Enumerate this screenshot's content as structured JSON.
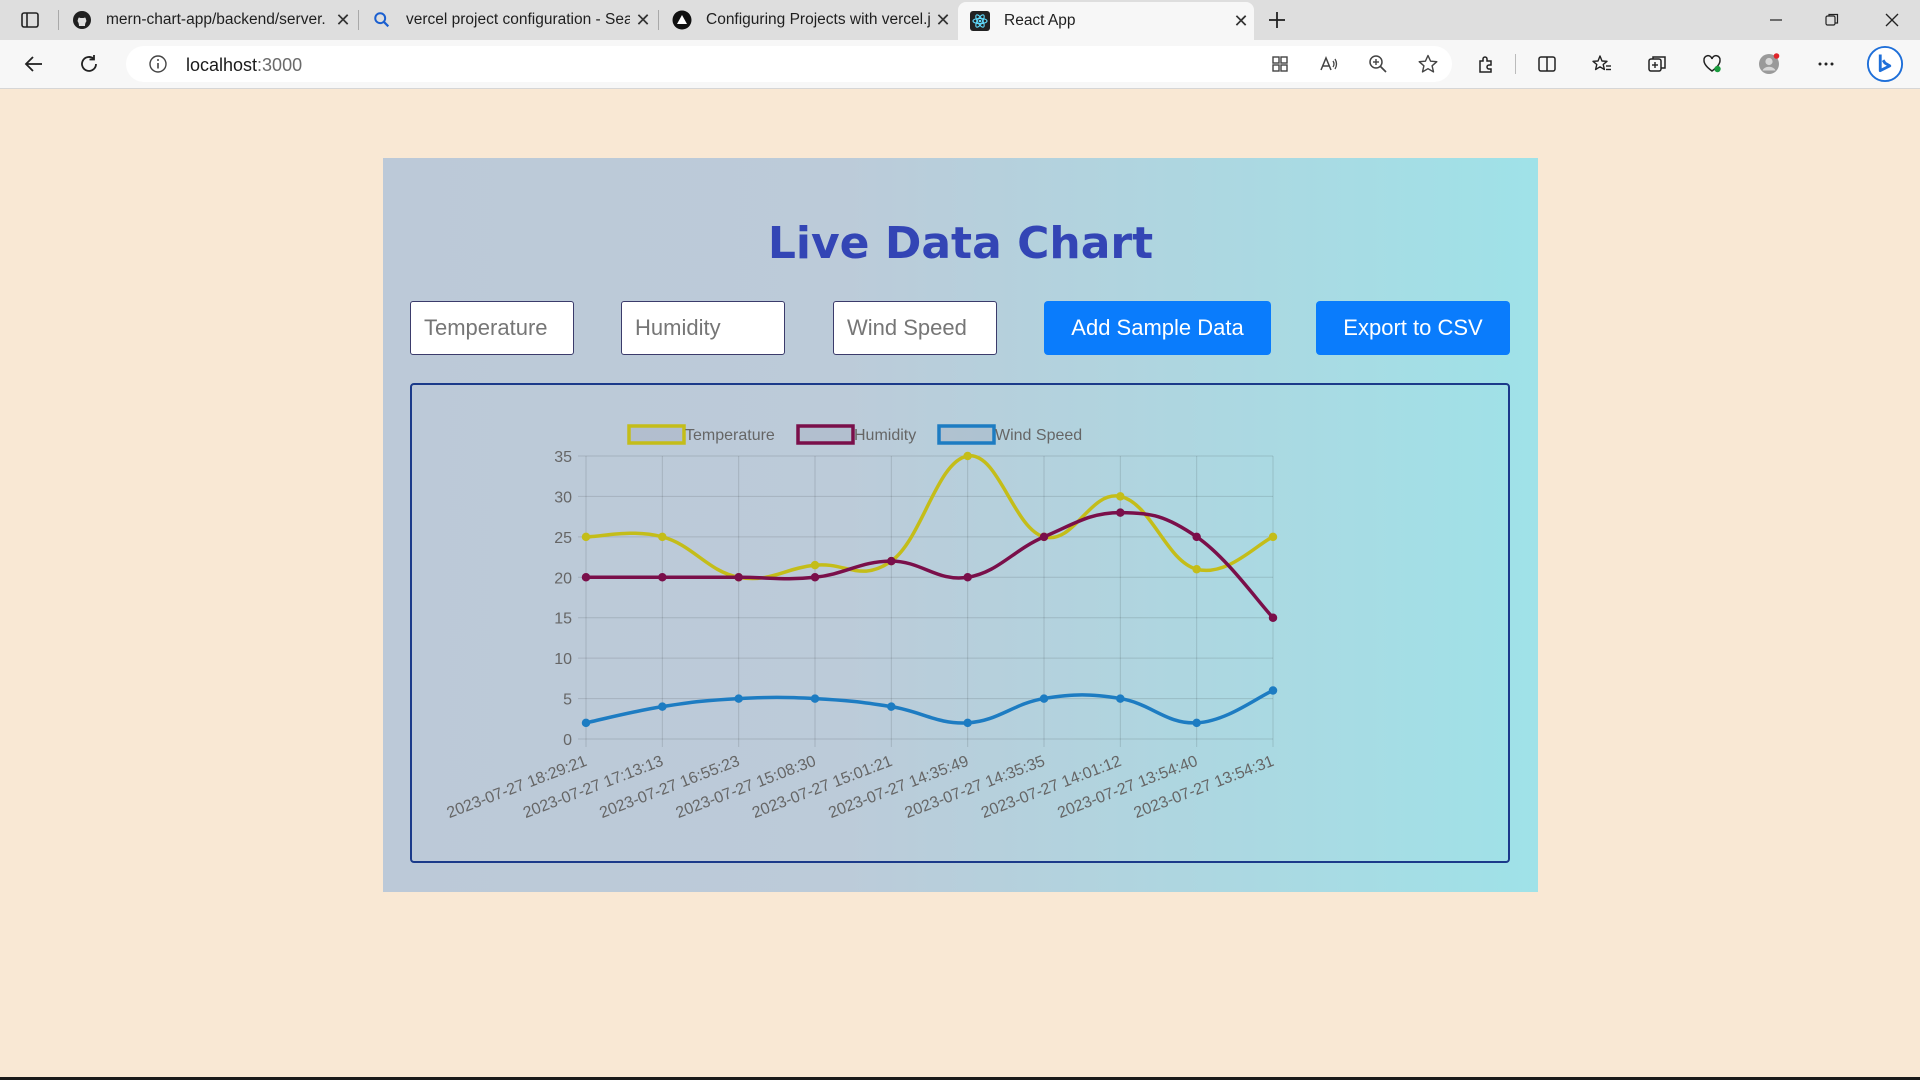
{
  "browser": {
    "tabs": [
      {
        "title": "mern-chart-app/backend/server.",
        "icon": "github-icon",
        "active": false
      },
      {
        "title": "vercel project configuration - Sea",
        "icon": "search-icon",
        "active": false
      },
      {
        "title": "Configuring Projects with vercel.j",
        "icon": "vercel-icon",
        "active": false
      },
      {
        "title": "React App",
        "icon": "react-icon",
        "active": true
      }
    ],
    "address": {
      "host": "localhost",
      "port": ":3000"
    }
  },
  "page": {
    "title": "Live Data Chart",
    "inputs": {
      "temperature_placeholder": "Temperature",
      "humidity_placeholder": "Humidity",
      "wind_placeholder": "Wind Speed"
    },
    "buttons": {
      "add_sample": "Add Sample Data",
      "export_csv": "Export to CSV"
    }
  },
  "colors": {
    "page_bg": "#f9e8d4",
    "title": "#3345b5",
    "button_bg": "#0a7cfc",
    "temperature": "#c4bd19",
    "humidity": "#7a0f4a",
    "wind": "#1d7cc2"
  },
  "chart_data": {
    "type": "line",
    "x": [
      "2023-07-27 18:29:21",
      "2023-07-27 17:13:13",
      "2023-07-27 16:55:23",
      "2023-07-27 15:08:30",
      "2023-07-27 15:01:21",
      "2023-07-27 14:35:49",
      "2023-07-27 14:35:35",
      "2023-07-27 14:01:12",
      "2023-07-27 13:54:40",
      "2023-07-27 13:54:31"
    ],
    "series": [
      {
        "name": "Temperature",
        "values": [
          25,
          25,
          20,
          21.5,
          22,
          35,
          25,
          30,
          21,
          25
        ]
      },
      {
        "name": "Humidity",
        "values": [
          20,
          20,
          20,
          20,
          22,
          20,
          25,
          28,
          25,
          15
        ]
      },
      {
        "name": "Wind Speed",
        "values": [
          2,
          4,
          5,
          5,
          4,
          2,
          5,
          5,
          2,
          6
        ]
      }
    ],
    "ylim": [
      0,
      35
    ],
    "yticks": [
      0,
      5,
      10,
      15,
      20,
      25,
      30,
      35
    ],
    "grid": true,
    "legend": "top"
  }
}
